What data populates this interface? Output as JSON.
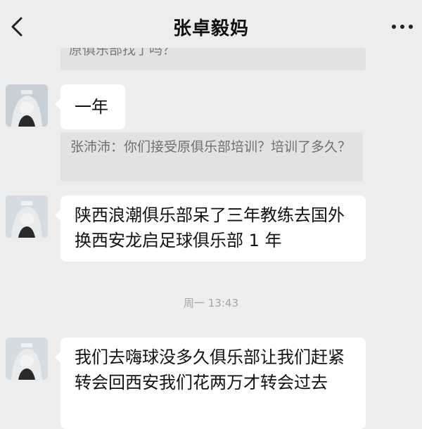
{
  "header": {
    "title": "张卓毅妈",
    "back_icon": "chevron-left-icon",
    "more_icon": "more-dots-icon"
  },
  "messages": {
    "quote_top": "原俱乐部找了吗？",
    "msg1": "一年",
    "quote_mid": "张沛沛：你们接受原俱乐部培训？培训了多久？",
    "msg2": "陕西浪潮俱乐部呆了三年教练去国外换西安龙启足球俱乐部 1 年",
    "timestamp": "周一 13:43",
    "msg3": "我们去嗨球没多久俱乐部让我们赶紧转会回西安我们花两万才转会过去"
  },
  "colors": {
    "background": "#ededed",
    "bubble": "#ffffff",
    "quote": "#e2e2e2"
  }
}
